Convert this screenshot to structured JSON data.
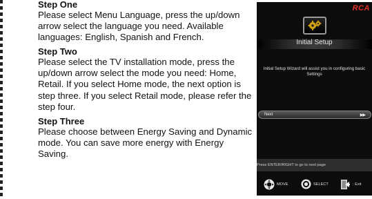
{
  "steps": [
    {
      "heading": "Step One",
      "body": "Please select Menu Language, press the up/down arrow select the language you need. Available languages: English, Spanish and French."
    },
    {
      "heading": "Step Two",
      "body": "Please select the TV installation mode, press the up/down arrow select the mode you need: Home, Retail. If you select Home mode, the next option is step three. If you select Retail mode, please refer the step four."
    },
    {
      "heading": "Step Three",
      "body": "Please choose between Energy Saving and Dynamic mode. You can save more energy with Energy Saving."
    }
  ],
  "tv_screen": {
    "brand": "RCA",
    "brand_color": "#e3322b",
    "icon": "gear-icon",
    "title": "Initial Setup",
    "description": "Initial Setup Wizard will assist you in configuring basic Settings",
    "next_label": "Next",
    "next_icon": "fast-forward-icon",
    "hint": "Press ENTER/RIGHT to go to next page",
    "nav": {
      "move_icon": "dpad-icon",
      "move_label": "MOVE",
      "select_icon": "select-button-icon",
      "select_label": "SELECT",
      "exit_icon": "exit-icon",
      "exit_label": ": Exit"
    }
  }
}
